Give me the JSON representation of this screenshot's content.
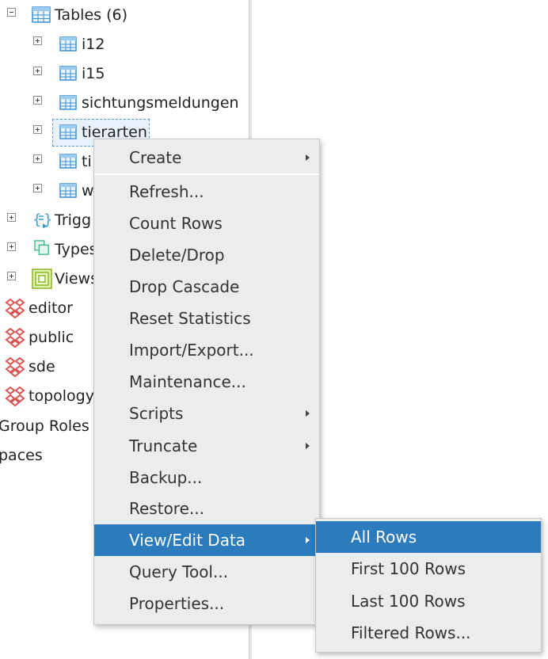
{
  "tree": {
    "tables_label": "Tables (6)",
    "tables": [
      "i12",
      "i15",
      "sichtungsmeldungen",
      "tierarten",
      "ti",
      "w"
    ],
    "triggers_label": "Trigg",
    "types_label": "Types",
    "views_label": "Views",
    "schemas": [
      "editor",
      "public",
      "sde",
      "topology"
    ],
    "group_roles_label": "Group Roles",
    "spaces_label": "paces"
  },
  "context_menu": {
    "items": [
      "Create",
      "Refresh...",
      "Count Rows",
      "Delete/Drop",
      "Drop Cascade",
      "Reset Statistics",
      "Import/Export...",
      "Maintenance...",
      "Scripts",
      "Truncate",
      "Backup...",
      "Restore...",
      "View/Edit Data",
      "Query Tool...",
      "Properties..."
    ],
    "active_item": "View/Edit Data"
  },
  "submenu": {
    "items": [
      "All Rows",
      "First 100 Rows",
      "Last 100 Rows",
      "Filtered Rows..."
    ],
    "active_item": "All Rows"
  },
  "colors": {
    "accent": "#2b7bbd",
    "menu_bg": "#ececec",
    "schema_icon": "#d9534f"
  }
}
